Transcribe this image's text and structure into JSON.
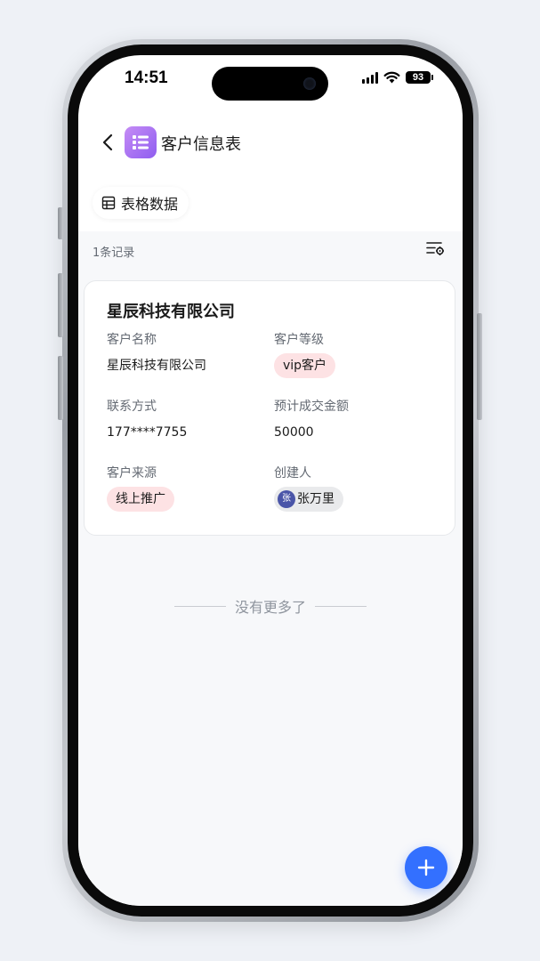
{
  "status_bar": {
    "time": "14:51",
    "battery": "93"
  },
  "header": {
    "title": "客户信息表",
    "back_icon": "chevron-left-icon",
    "app_icon": "table-list-icon",
    "app_icon_color": "#a46ff2"
  },
  "view_tab": {
    "label": "表格数据",
    "icon": "grid-table-icon"
  },
  "list": {
    "record_count": "1条记录",
    "settings_icon": "filter-settings-icon",
    "end_text": "没有更多了"
  },
  "record": {
    "title": "星辰科技有限公司",
    "fields": {
      "customer_name": {
        "label": "客户名称",
        "value": "星辰科技有限公司"
      },
      "customer_level": {
        "label": "客户等级",
        "value": "vip客户",
        "tag_color": "#fde2e4"
      },
      "contact": {
        "label": "联系方式",
        "value": "177****7755"
      },
      "expected_amount": {
        "label": "预计成交金额",
        "value": "50000"
      },
      "source": {
        "label": "客户来源",
        "value": "线上推广",
        "tag_color": "#fde2e4"
      },
      "creator": {
        "label": "创建人",
        "avatar_text": "张",
        "value": "张万里"
      }
    }
  },
  "colors": {
    "accent": "#3370ff",
    "list_background": "#f7f8fa",
    "tag_pink": "#fde2e4"
  },
  "fab": {
    "icon": "plus-icon"
  }
}
